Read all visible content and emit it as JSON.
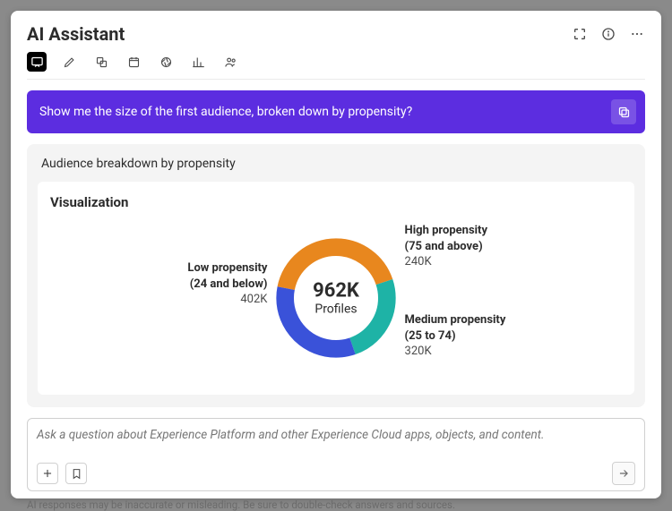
{
  "header": {
    "title": "AI Assistant"
  },
  "prompt": {
    "text": "Show me the size of the first audience, broken down by propensity?"
  },
  "result": {
    "title": "Audience breakdown by propensity",
    "viz_title": "Visualization",
    "center_value": "962K",
    "center_label": "Profiles",
    "segments": {
      "low": {
        "name": "Low propensity",
        "range": "(24 and below)",
        "value": "402K"
      },
      "high": {
        "name": "High propensity",
        "range": "(75 and above)",
        "value": "240K"
      },
      "med": {
        "name": "Medium propensity",
        "range": "(25 to 74)",
        "value": "320K"
      }
    }
  },
  "input": {
    "placeholder": "Ask a question about Experience Platform and other Experience Cloud apps, objects, and content."
  },
  "disclaimer": "AI responses may be inaccurate or misleading. Be sure to double-check answers and sources.",
  "chart_data": {
    "type": "pie",
    "title": "Audience breakdown by propensity",
    "total_label": "Profiles",
    "total_value": 962000,
    "series": [
      {
        "name": "Low propensity (24 and below)",
        "value": 402000,
        "color": "#e8871e"
      },
      {
        "name": "High propensity (75 and above)",
        "value": 240000,
        "color": "#1eb3a6"
      },
      {
        "name": "Medium propensity (25 to 74)",
        "value": 320000,
        "color": "#3a52d9"
      }
    ]
  }
}
